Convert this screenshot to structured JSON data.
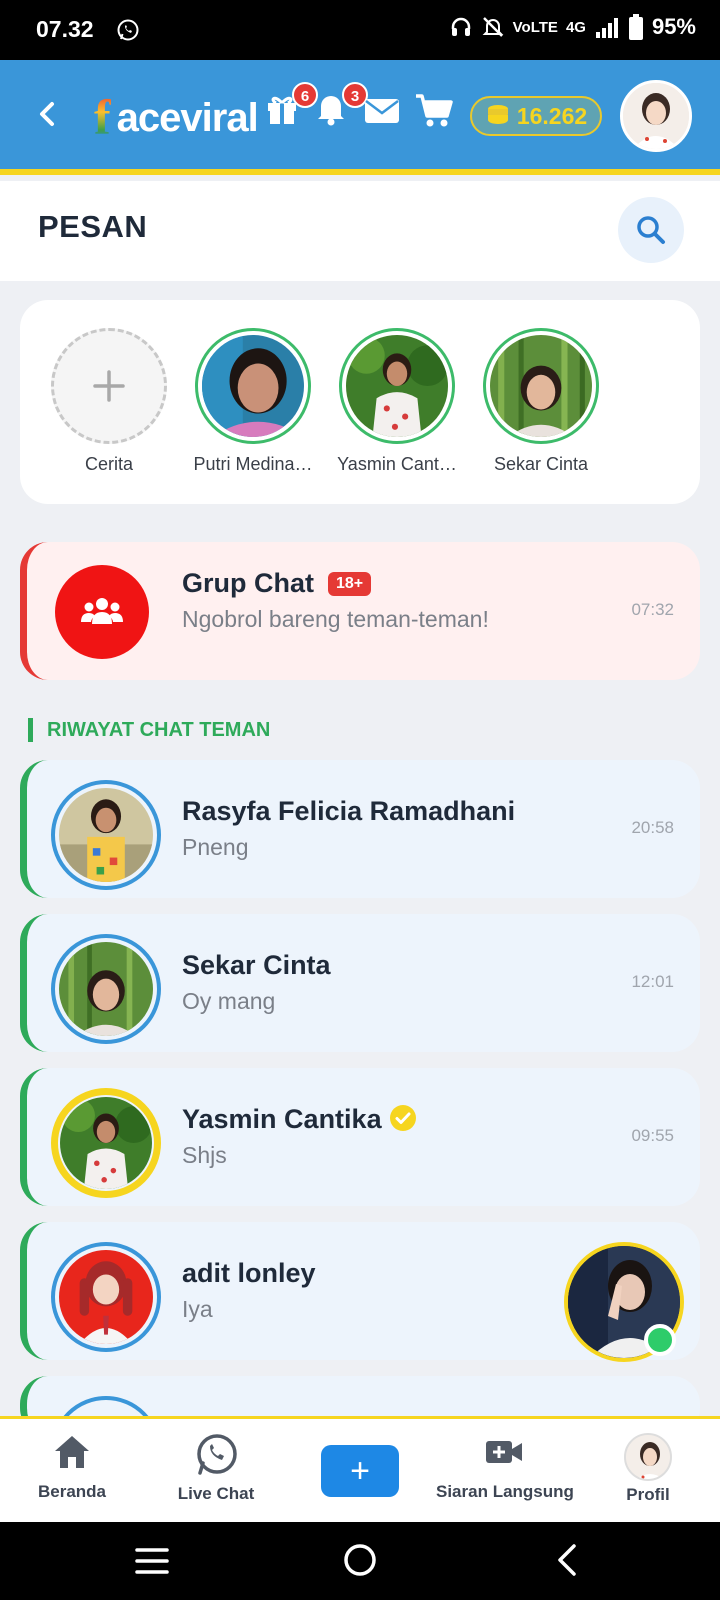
{
  "status_bar": {
    "time": "07.32",
    "volte": "VoLTE",
    "network": "4G",
    "battery": "95%"
  },
  "header": {
    "logo_f": "f",
    "logo_text": "aceviral",
    "gift_badge": "6",
    "bell_badge": "3",
    "coins": "16.262",
    "icons": [
      "back-arrow-icon",
      "gift-icon",
      "bell-icon",
      "mail-icon",
      "cart-icon",
      "coin-stack-icon"
    ]
  },
  "page": {
    "title": "PESAN"
  },
  "stories": [
    {
      "label": "Cerita"
    },
    {
      "label": "Putri Medina…"
    },
    {
      "label": "Yasmin Cant…"
    },
    {
      "label": "Sekar Cinta"
    }
  ],
  "group_chat": {
    "name": "Grup Chat",
    "badge": "18+",
    "message": "Ngobrol bareng teman-teman!",
    "time": "07:32"
  },
  "section": {
    "label": "RIWAYAT CHAT TEMAN"
  },
  "chats": [
    {
      "name": "Rasyfa Felicia Ramadhani",
      "message": "Pneng",
      "time": "20:58"
    },
    {
      "name": "Sekar Cinta",
      "message": "Oy mang",
      "time": "12:01"
    },
    {
      "name": "Yasmin Cantika",
      "message": "Shjs",
      "time": "09:55"
    },
    {
      "name": "adit lonley",
      "message": "Iya",
      "time": ""
    }
  ],
  "nav": {
    "home": "Beranda",
    "live_chat": "Live Chat",
    "add": "+",
    "broadcast": "Siaran Langsung",
    "profile": "Profil"
  },
  "colors": {
    "header_blue": "#3a96d9",
    "accent_yellow": "#f6d51f",
    "group_red": "#f01414",
    "online_green": "#2ecc6a"
  }
}
